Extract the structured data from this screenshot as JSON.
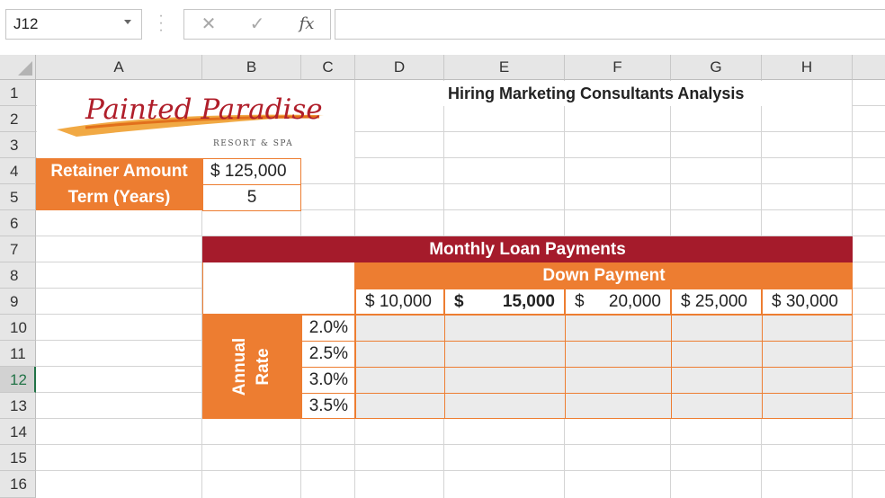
{
  "formula_bar": {
    "name_box": "J12",
    "cancel_icon": "cancel-icon",
    "enter_icon": "checkmark-icon",
    "fx_label": "fx",
    "formula": ""
  },
  "columns": [
    "A",
    "B",
    "C",
    "D",
    "E",
    "F",
    "G",
    "H"
  ],
  "rows": [
    "1",
    "2",
    "3",
    "4",
    "5",
    "6",
    "7",
    "8",
    "9",
    "10",
    "11",
    "12",
    "13",
    "14",
    "15",
    "16"
  ],
  "selected_row": "12",
  "logo": {
    "line1": "Painted Paradise",
    "line2": "RESORT & SPA"
  },
  "sheet": {
    "title": "Hiring Marketing Consultants Analysis",
    "retainer_label": "Retainer Amount",
    "retainer_value": "$ 125,000",
    "term_label": "Term (Years)",
    "term_value": "5",
    "table_title": "Monthly Loan Payments",
    "down_payment_label": "Down Payment",
    "annual_rate_label_line1": "Annual",
    "annual_rate_label_line2": "Rate",
    "down_payments": [
      {
        "cur": "$",
        "amt": "10,000"
      },
      {
        "cur": "$",
        "amt": "15,000"
      },
      {
        "cur": "$",
        "amt": "20,000"
      },
      {
        "cur": "$",
        "amt": "25,000"
      },
      {
        "cur": "$",
        "amt": "30,000"
      }
    ],
    "rates": [
      "2.0%",
      "2.5%",
      "3.0%",
      "3.5%"
    ]
  },
  "colors": {
    "orange": "#ed7d31",
    "dark_red": "#a51b2b",
    "selected_green": "#217346",
    "logo_red": "#b01e2a"
  }
}
